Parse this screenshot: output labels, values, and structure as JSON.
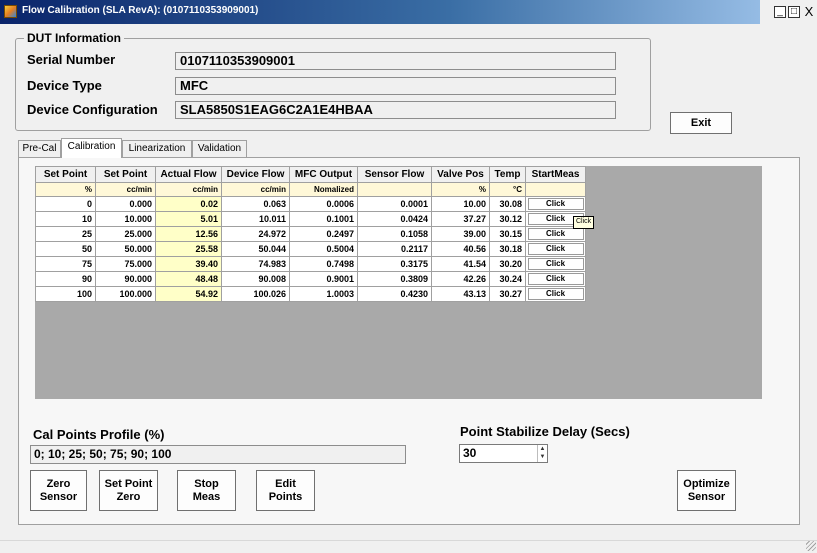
{
  "window": {
    "title": "Flow Calibration  (SLA RevA): (0107110353909001)",
    "min": "_",
    "max": "□",
    "close": "X"
  },
  "dut": {
    "legend": "DUT Information",
    "serial_label": "Serial Number",
    "serial_value": "0107110353909001",
    "type_label": "Device Type",
    "type_value": "MFC",
    "config_label": "Device Configuration",
    "config_value": "SLA5850S1EAG6C2A1E4HBAA"
  },
  "exit_label": "Exit",
  "tabs": [
    {
      "label": "Pre-Cal",
      "active": false
    },
    {
      "label": "Calibration",
      "active": true
    },
    {
      "label": "Linearization",
      "active": false
    },
    {
      "label": "Validation",
      "active": false
    }
  ],
  "grid": {
    "headers": [
      "Set Point",
      "Set Point",
      "Actual Flow",
      "Device Flow",
      "MFC Output",
      "Sensor Flow",
      "Valve Pos",
      "Temp",
      "StartMeas"
    ],
    "units": [
      "%",
      "cc/min",
      "cc/min",
      "cc/min",
      "Nomalized",
      "",
      "%",
      "°C",
      ""
    ],
    "rows": [
      [
        "0",
        "0.000",
        "0.02",
        "0.063",
        "0.0006",
        "0.0001",
        "10.00",
        "30.08",
        "Click"
      ],
      [
        "10",
        "10.000",
        "5.01",
        "10.011",
        "0.1001",
        "0.0424",
        "37.27",
        "30.12",
        "Click"
      ],
      [
        "25",
        "25.000",
        "12.56",
        "24.972",
        "0.2497",
        "0.1058",
        "39.00",
        "30.15",
        "Click"
      ],
      [
        "50",
        "50.000",
        "25.58",
        "50.044",
        "0.5004",
        "0.2117",
        "40.56",
        "30.18",
        "Click"
      ],
      [
        "75",
        "75.000",
        "39.40",
        "74.983",
        "0.7498",
        "0.3175",
        "41.54",
        "30.20",
        "Click"
      ],
      [
        "90",
        "90.000",
        "48.48",
        "90.008",
        "0.9001",
        "0.3809",
        "42.26",
        "30.24",
        "Click"
      ],
      [
        "100",
        "100.000",
        "54.92",
        "100.026",
        "1.0003",
        "0.4230",
        "43.13",
        "30.27",
        "Click"
      ]
    ],
    "tooltip": "Click"
  },
  "profile": {
    "label": "Cal Points Profile (%)",
    "value": "0; 10; 25; 50; 75; 90; 100"
  },
  "delay": {
    "label": "Point Stabilize Delay (Secs)",
    "value": "30"
  },
  "buttons": {
    "zero_sensor": "Zero\nSensor",
    "set_point_zero": "Set Point\nZero",
    "stop_meas": "Stop\nMeas",
    "edit_points": "Edit\nPoints",
    "optimize_sensor": "Optimize\nSensor"
  }
}
